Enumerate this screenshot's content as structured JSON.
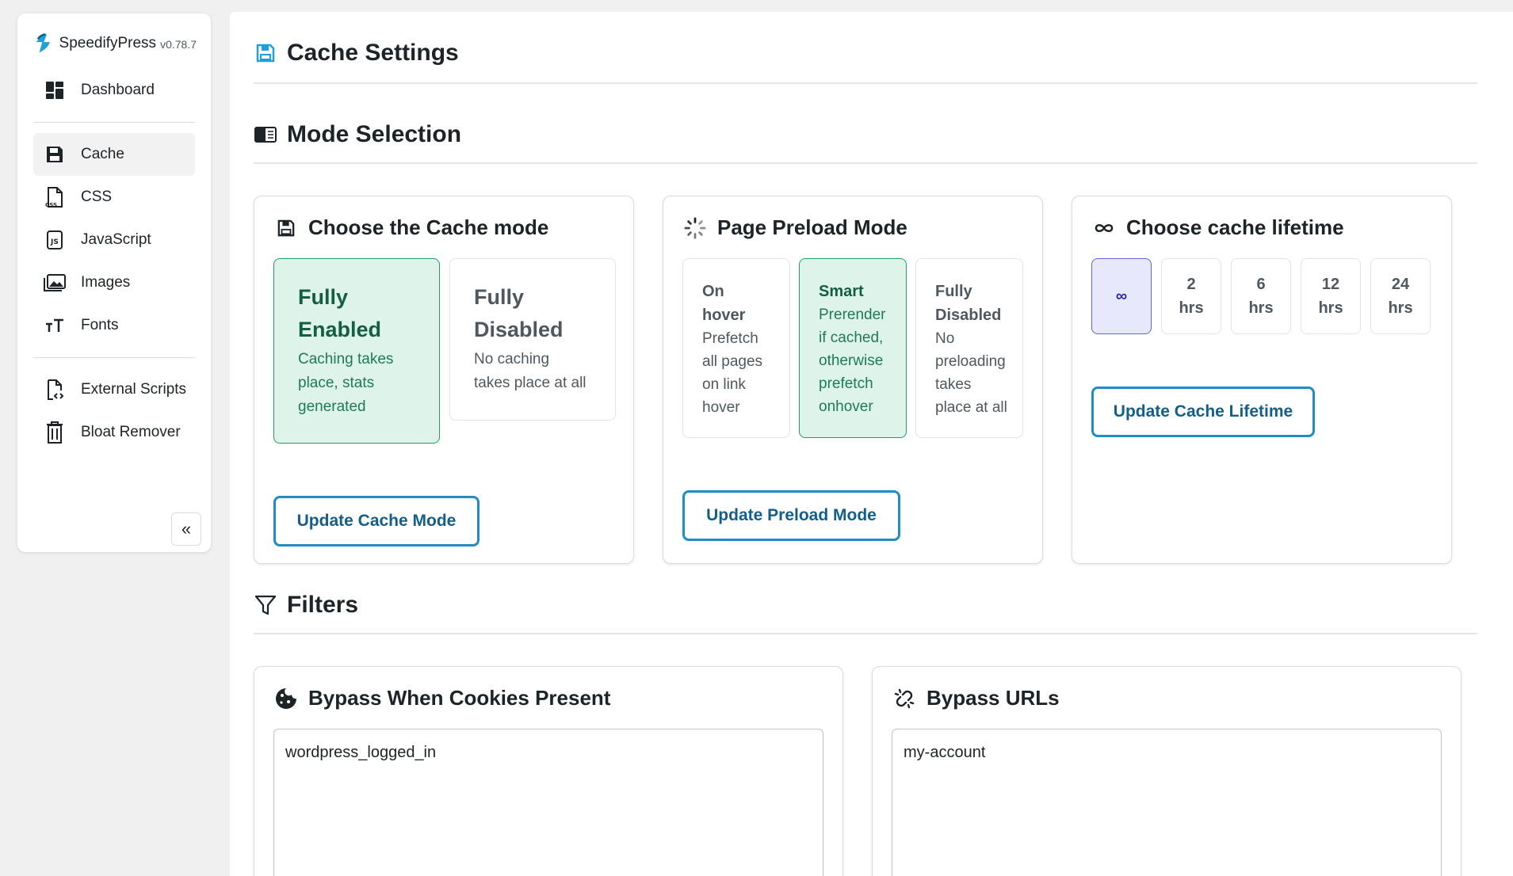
{
  "app": {
    "name": "SpeedifyPress",
    "version": "v0.78.7"
  },
  "sidebar": {
    "items": [
      {
        "label": "Dashboard",
        "icon": "dashboard-icon"
      },
      {
        "label": "Cache",
        "icon": "floppy-disk-icon",
        "active": true
      },
      {
        "label": "CSS",
        "icon": "css-file-icon"
      },
      {
        "label": "JavaScript",
        "icon": "js-file-icon"
      },
      {
        "label": "Images",
        "icon": "images-icon"
      },
      {
        "label": "Fonts",
        "icon": "font-size-icon"
      },
      {
        "label": "External Scripts",
        "icon": "external-file-icon"
      },
      {
        "label": "Bloat Remover",
        "icon": "trash-icon"
      }
    ],
    "collapse_label": "«"
  },
  "page": {
    "title": "Cache Settings"
  },
  "mode_selection": {
    "title": "Mode Selection",
    "cache_mode": {
      "title": "Choose the Cache mode",
      "options": [
        {
          "title_l1": "Fully",
          "title_l2": "Enabled",
          "desc_l1": "Caching takes",
          "desc_l2": "place, stats",
          "desc_l3": "generated",
          "selected": true
        },
        {
          "title_l1": "Fully",
          "title_l2": "Disabled",
          "desc_l1": "No caching",
          "desc_l2": "takes place at all",
          "desc_l3": "",
          "selected": false
        }
      ],
      "button": "Update Cache Mode"
    },
    "preload_mode": {
      "title": "Page Preload Mode",
      "options": [
        {
          "lines_title": [
            "On",
            "hover"
          ],
          "lines_desc": [
            "Prefetch",
            "all pages",
            "on link",
            "hover"
          ],
          "selected": false
        },
        {
          "lines_title": [
            "Smart"
          ],
          "lines_desc": [
            "Prerender",
            "if cached,",
            "otherwise",
            "prefetch",
            "onhover"
          ],
          "selected": true
        },
        {
          "lines_title": [
            "Fully",
            "Disabled"
          ],
          "lines_desc": [
            "No",
            "preloading",
            "takes",
            "place at all"
          ],
          "selected": false
        }
      ],
      "button": "Update Preload Mode"
    },
    "lifetime": {
      "title": "Choose cache lifetime",
      "options": [
        {
          "l1": "∞",
          "l2": "",
          "selected": true
        },
        {
          "l1": "2",
          "l2": "hrs",
          "selected": false
        },
        {
          "l1": "6",
          "l2": "hrs",
          "selected": false
        },
        {
          "l1": "12",
          "l2": "hrs",
          "selected": false
        },
        {
          "l1": "24",
          "l2": "hrs",
          "selected": false
        }
      ],
      "button": "Update Cache Lifetime"
    }
  },
  "filters": {
    "title": "Filters",
    "cookies": {
      "title": "Bypass When Cookies Present",
      "value": "wordpress_logged_in"
    },
    "urls": {
      "title": "Bypass URLs",
      "value": "my-account"
    }
  },
  "colors": {
    "accent": "#1f8cc4",
    "selected_green": "#def4ea",
    "selected_purple": "#e8e8fc",
    "brand_blue": "#1fa0d8"
  }
}
